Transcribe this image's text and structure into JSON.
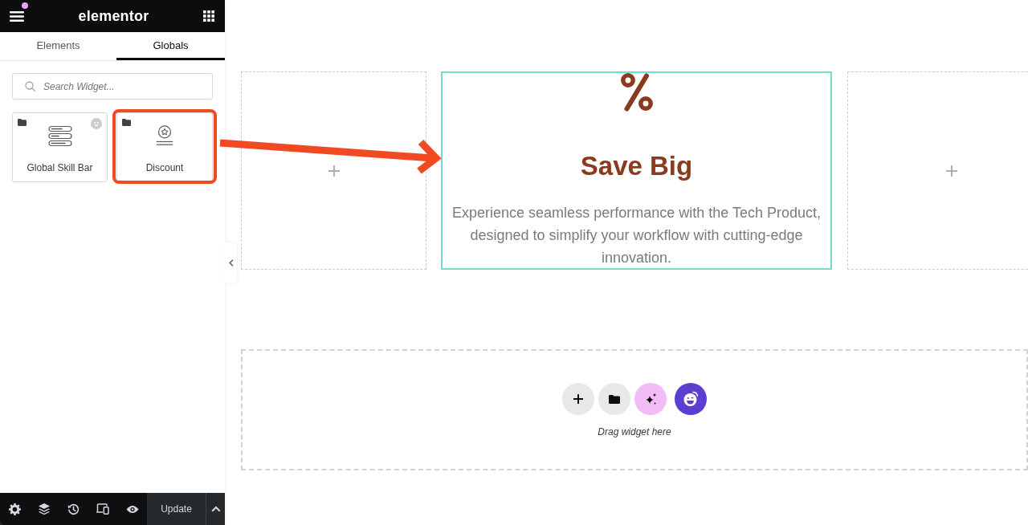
{
  "panel": {
    "logo": "elementor",
    "tabs": [
      {
        "label": "Elements",
        "selected": false
      },
      {
        "label": "Globals",
        "selected": true
      }
    ],
    "search": {
      "placeholder": "Search Widget..."
    },
    "widgets": [
      {
        "label": "Global Skill Bar",
        "kind": "skill-bar",
        "badge": true,
        "highlighted": false
      },
      {
        "label": "Discount",
        "kind": "discount",
        "badge": false,
        "highlighted": true
      }
    ],
    "footer": {
      "update_button": "Update"
    }
  },
  "canvas": {
    "columns": [
      {
        "kind": "empty",
        "selected": false
      },
      {
        "kind": "discount-box",
        "selected": true,
        "heading": "Save Big",
        "text": "Experience seamless performance with the Tech Product, designed to simplify your workflow with cutting-edge innovation."
      },
      {
        "kind": "empty",
        "selected": false
      }
    ],
    "drop_zone": {
      "buttons": [
        {
          "kind": "add"
        },
        {
          "kind": "template"
        },
        {
          "kind": "ai"
        },
        {
          "kind": "assistant"
        }
      ],
      "hint": "Drag widget here"
    }
  }
}
